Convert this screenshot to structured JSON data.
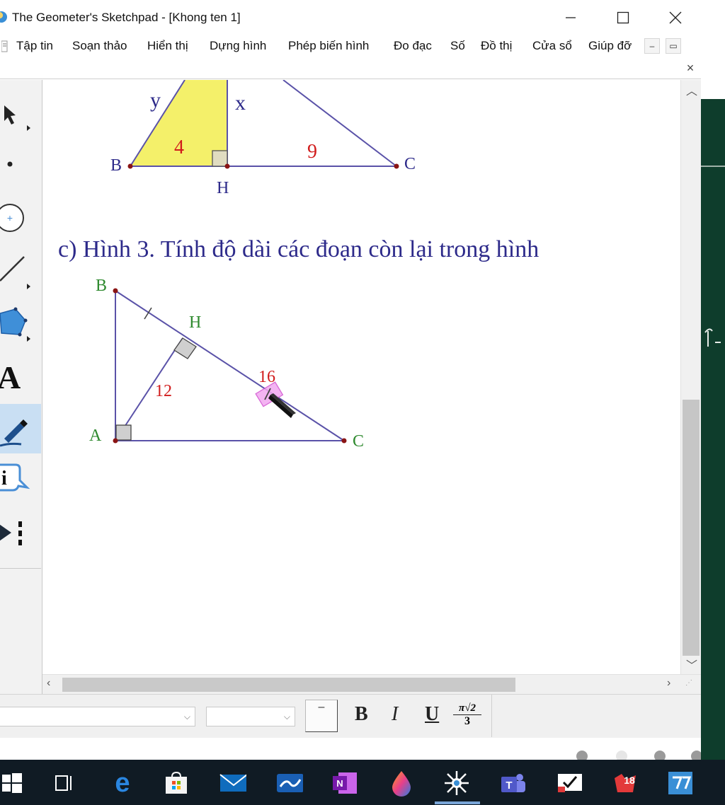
{
  "window": {
    "title": "The Geometer's Sketchpad - [Khong ten 1]"
  },
  "menu": [
    "Tập tin",
    "Soạn thảo",
    "Hiển thị",
    "Dựng hình",
    "Phép biến hình",
    "Đo đạc",
    "Số",
    "Đồ thị",
    "Cửa sổ",
    "Giúp đỡ"
  ],
  "tools": [
    "selection-arrow",
    "point",
    "compass",
    "straightedge",
    "polygon",
    "text",
    "marker",
    "information",
    "custom-tools"
  ],
  "text_tool_label": "A",
  "info_tool_label": "i",
  "figure_top": {
    "labels": {
      "y": "y",
      "x": "x",
      "b": "B",
      "h": "H",
      "c": "C"
    },
    "measures": {
      "ah": "4",
      "hc": "9"
    },
    "fill_color": "#f4f06a",
    "line_color": "#5a52a8"
  },
  "heading": "c) Hình 3. Tính độ dài các đoạn còn lại trong hình",
  "figure_bottom": {
    "labels": {
      "b": "B",
      "h": "H",
      "a": "A",
      "c": "C"
    },
    "measures": {
      "ah": "12",
      "hc": "16"
    },
    "vertex_label_color": "#2f8a2f",
    "measure_color": "#d11c1c"
  },
  "format_bar": {
    "symbol_button": "–",
    "bold": "B",
    "italic": "I",
    "underline": "U",
    "fraction_top": "π√2",
    "fraction_bottom": "3"
  },
  "taskbar": {
    "apps": [
      "start",
      "task-view",
      "edge",
      "store",
      "mail",
      "whiteboard",
      "onenote",
      "paint",
      "sketchpad",
      "teams",
      "my-app",
      "calendar",
      "classroom"
    ],
    "badge": "18"
  }
}
